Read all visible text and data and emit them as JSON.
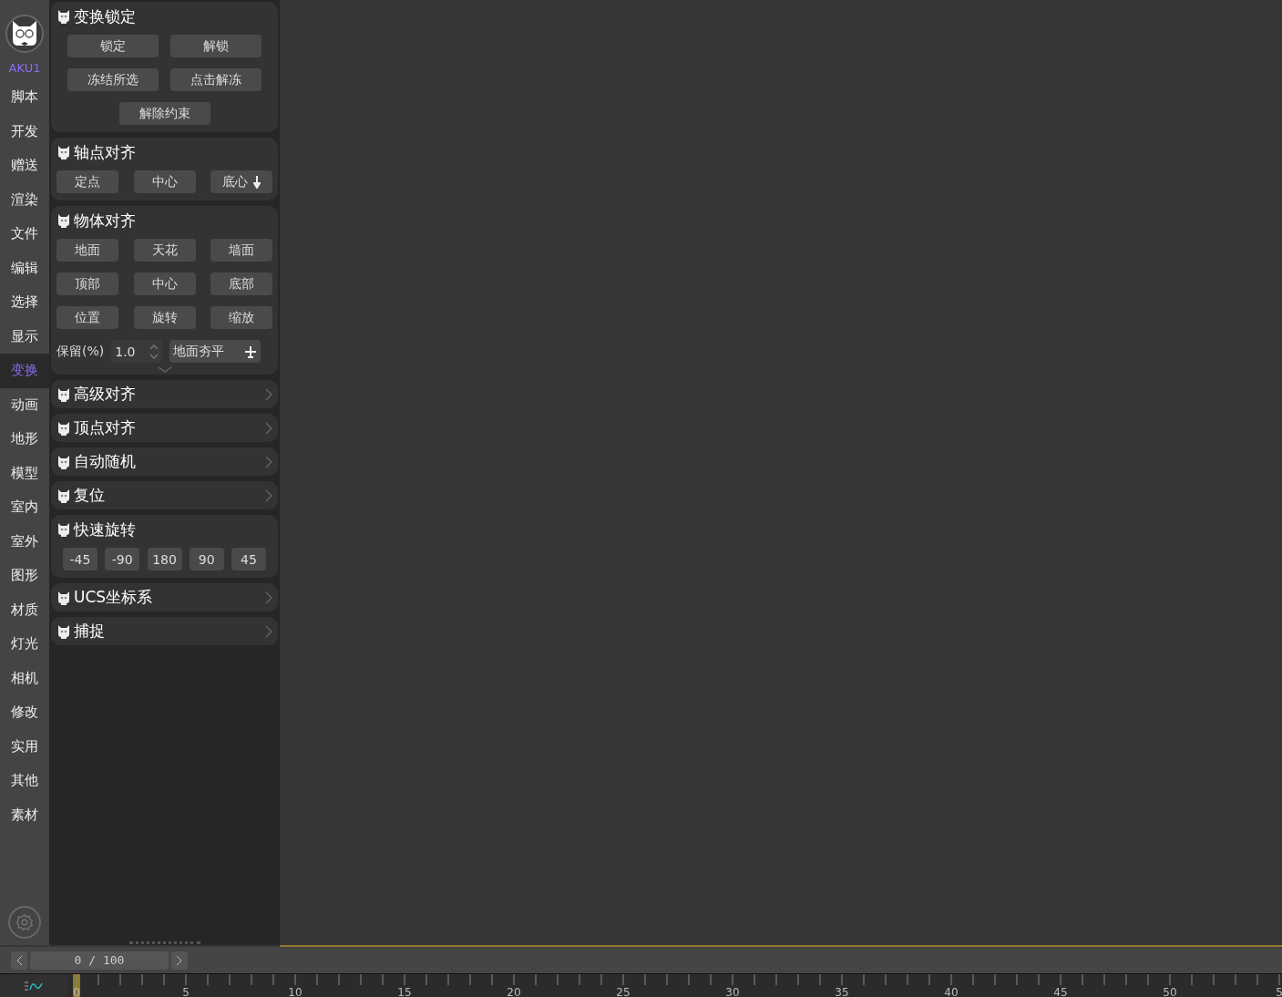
{
  "sidebar": {
    "logo_text": "AKU1",
    "items": [
      {
        "label": "脚本",
        "selected": false
      },
      {
        "label": "开发",
        "selected": false
      },
      {
        "label": "赠送",
        "selected": false
      },
      {
        "label": "渲染",
        "selected": false
      },
      {
        "label": "文件",
        "selected": false
      },
      {
        "label": "编辑",
        "selected": false
      },
      {
        "label": "选择",
        "selected": false
      },
      {
        "label": "显示",
        "selected": false
      },
      {
        "label": "变换",
        "selected": true
      },
      {
        "label": "动画",
        "selected": false
      },
      {
        "label": "地形",
        "selected": false
      },
      {
        "label": "模型",
        "selected": false
      },
      {
        "label": "室内",
        "selected": false
      },
      {
        "label": "室外",
        "selected": false
      },
      {
        "label": "图形",
        "selected": false
      },
      {
        "label": "材质",
        "selected": false
      },
      {
        "label": "灯光",
        "selected": false
      },
      {
        "label": "相机",
        "selected": false
      },
      {
        "label": "修改",
        "selected": false
      },
      {
        "label": "实用",
        "selected": false
      },
      {
        "label": "其他",
        "selected": false
      },
      {
        "label": "素材",
        "selected": false
      }
    ]
  },
  "sections": [
    {
      "title": "变换锁定",
      "expanded": true,
      "rows": [
        {
          "kind": "wide",
          "buttons": [
            {
              "label": "锁定"
            },
            {
              "label": "解锁"
            }
          ]
        },
        {
          "kind": "wide",
          "buttons": [
            {
              "label": "冻结所选"
            },
            {
              "label": "点击解冻"
            }
          ]
        },
        {
          "kind": "wide",
          "buttons": [
            {
              "label": "解除约束"
            }
          ]
        }
      ]
    },
    {
      "title": "轴点对齐",
      "expanded": true,
      "rows": [
        {
          "kind": "grid",
          "buttons": [
            {
              "label": "定点"
            },
            {
              "label": "中心"
            },
            {
              "label": "底心",
              "kind": "arrow"
            }
          ]
        }
      ]
    },
    {
      "title": "物体对齐",
      "expanded": true,
      "more": true,
      "rows": [
        {
          "kind": "grid",
          "buttons": [
            {
              "label": "地面"
            },
            {
              "label": "天花"
            },
            {
              "label": "墙面"
            }
          ]
        },
        {
          "kind": "grid",
          "buttons": [
            {
              "label": "顶部"
            },
            {
              "label": "中心"
            },
            {
              "label": "底部"
            }
          ]
        },
        {
          "kind": "grid",
          "buttons": [
            {
              "label": "位置"
            },
            {
              "label": "旋转"
            },
            {
              "label": "缩放"
            }
          ]
        },
        {
          "kind": "spinner",
          "label": "保留(%)",
          "value": "1.0",
          "button": {
            "label": "地面夯平",
            "kind": "plane"
          }
        }
      ]
    },
    {
      "title": "高级对齐",
      "expanded": false
    },
    {
      "title": "顶点对齐",
      "expanded": false
    },
    {
      "title": "自动随机",
      "expanded": false
    },
    {
      "title": "复位",
      "expanded": false
    },
    {
      "title": "快速旋转",
      "expanded": true,
      "rows": [
        {
          "kind": "small",
          "buttons": [
            {
              "label": "-45"
            },
            {
              "label": "-90"
            },
            {
              "label": "180"
            },
            {
              "label": "90"
            },
            {
              "label": "45"
            }
          ]
        }
      ]
    },
    {
      "title": "UCS坐标系",
      "expanded": false
    },
    {
      "title": "捕捉",
      "expanded": false
    }
  ],
  "timeline": {
    "frame": "0 / 100",
    "ruler_labels": [
      "0",
      "5",
      "10",
      "15",
      "20",
      "25",
      "30",
      "35",
      "40",
      "45",
      "50",
      "5"
    ]
  }
}
